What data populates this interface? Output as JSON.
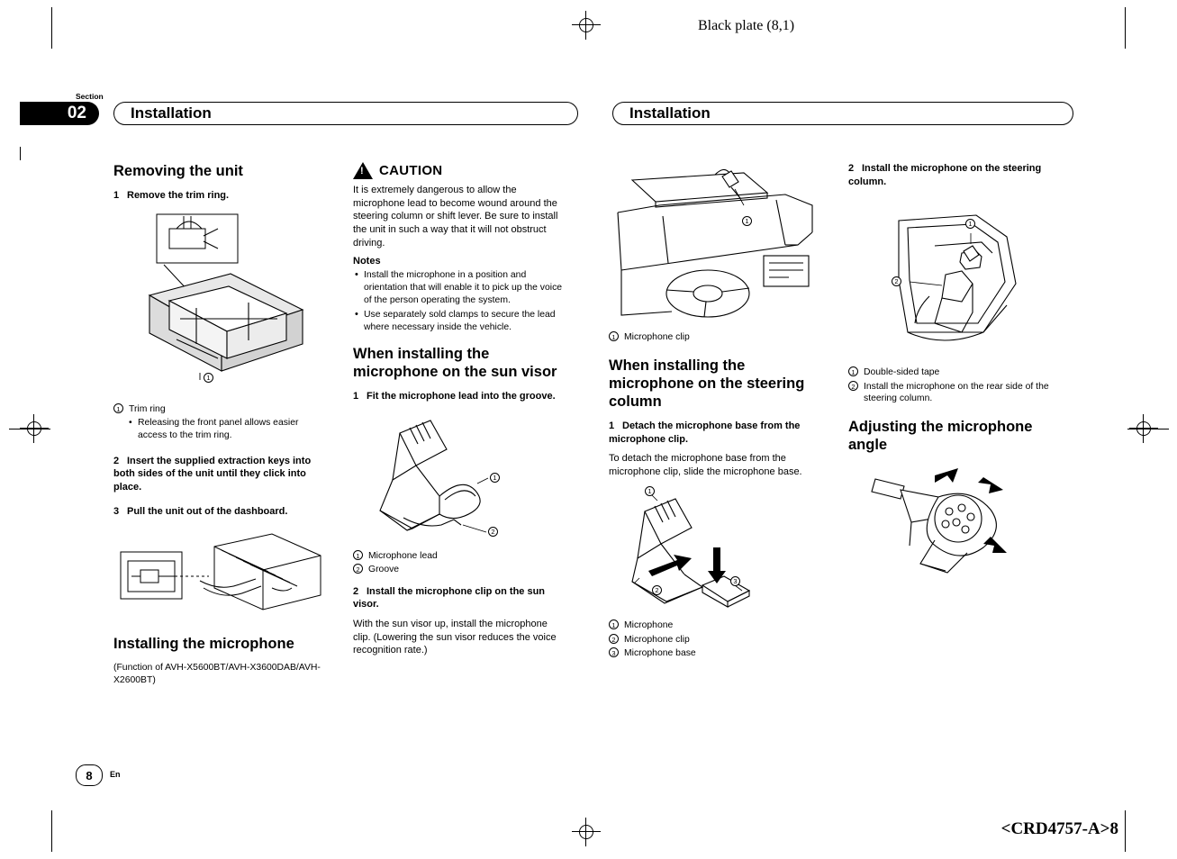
{
  "page": {
    "black_plate": "Black plate (8,1)",
    "crd_code": "<CRD4757-A>8",
    "section_label": "Section",
    "section_number": "02",
    "page_number": "8",
    "page_lang": "En",
    "header_left": "Installation",
    "header_right": "Installation"
  },
  "col1": {
    "h_removing": "Removing the unit",
    "step1": "Remove the trim ring.",
    "step1_num": "1",
    "fig1_callout1": "1",
    "legend1_item1_num": "1",
    "legend1_item1": "Trim ring",
    "legend1_bullet": "Releasing the front panel allows easier access to the trim ring.",
    "step2_num": "2",
    "step2": "Insert the supplied extraction keys into both sides of the unit until they click into place.",
    "step3_num": "3",
    "step3": "Pull the unit out of the dashboard.",
    "h_installing_mic": "Installing the microphone",
    "mic_function": "(Function of AVH-X5600BT/AVH-X3600DAB/AVH-X2600BT)"
  },
  "col2": {
    "caution_title": "CAUTION",
    "caution_body": "It is extremely dangerous to allow the microphone lead to become wound around the steering column or shift lever. Be sure to install the unit in such a way that it will not obstruct driving.",
    "notes_title": "Notes",
    "note1": "Install the microphone in a position and orientation that will enable it to pick up the voice of the person operating the system.",
    "note2": "Use separately sold clamps to secure the lead where necessary inside the vehicle.",
    "h_sunvisor": "When installing the microphone on the sun visor",
    "step1_num": "1",
    "step1": "Fit the microphone lead into the groove.",
    "fig_callout1": "1",
    "fig_callout2": "2",
    "legend_num1": "1",
    "legend_item1": "Microphone lead",
    "legend_num2": "2",
    "legend_item2": "Groove",
    "step2_num": "2",
    "step2": "Install the microphone clip on the sun visor.",
    "step2_body": "With the sun visor up, install the microphone clip. (Lowering the sun visor reduces the voice recognition rate.)"
  },
  "col3": {
    "fig_callout1": "1",
    "legend_num1": "1",
    "legend_item1": "Microphone clip",
    "h_steering": "When installing the microphone on the steering column",
    "step1_num": "1",
    "step1": "Detach the microphone base from the microphone clip.",
    "step1_body": "To detach the microphone base from the microphone clip, slide the microphone base.",
    "fig2_callout1": "1",
    "fig2_callout2": "2",
    "fig2_callout3": "3",
    "legend2_num1": "1",
    "legend2_item1": "Microphone",
    "legend2_num2": "2",
    "legend2_item2": "Microphone clip",
    "legend2_num3": "3",
    "legend2_item3": "Microphone base"
  },
  "col4": {
    "step2_num": "2",
    "step2": "Install the microphone on the steering column.",
    "fig_callout1": "1",
    "fig_callout2": "2",
    "legend_num1": "1",
    "legend_item1": "Double-sided tape",
    "legend_num2": "2",
    "legend_item2": "Install the microphone on the rear side of the steering column.",
    "h_adjusting": "Adjusting the microphone angle"
  }
}
